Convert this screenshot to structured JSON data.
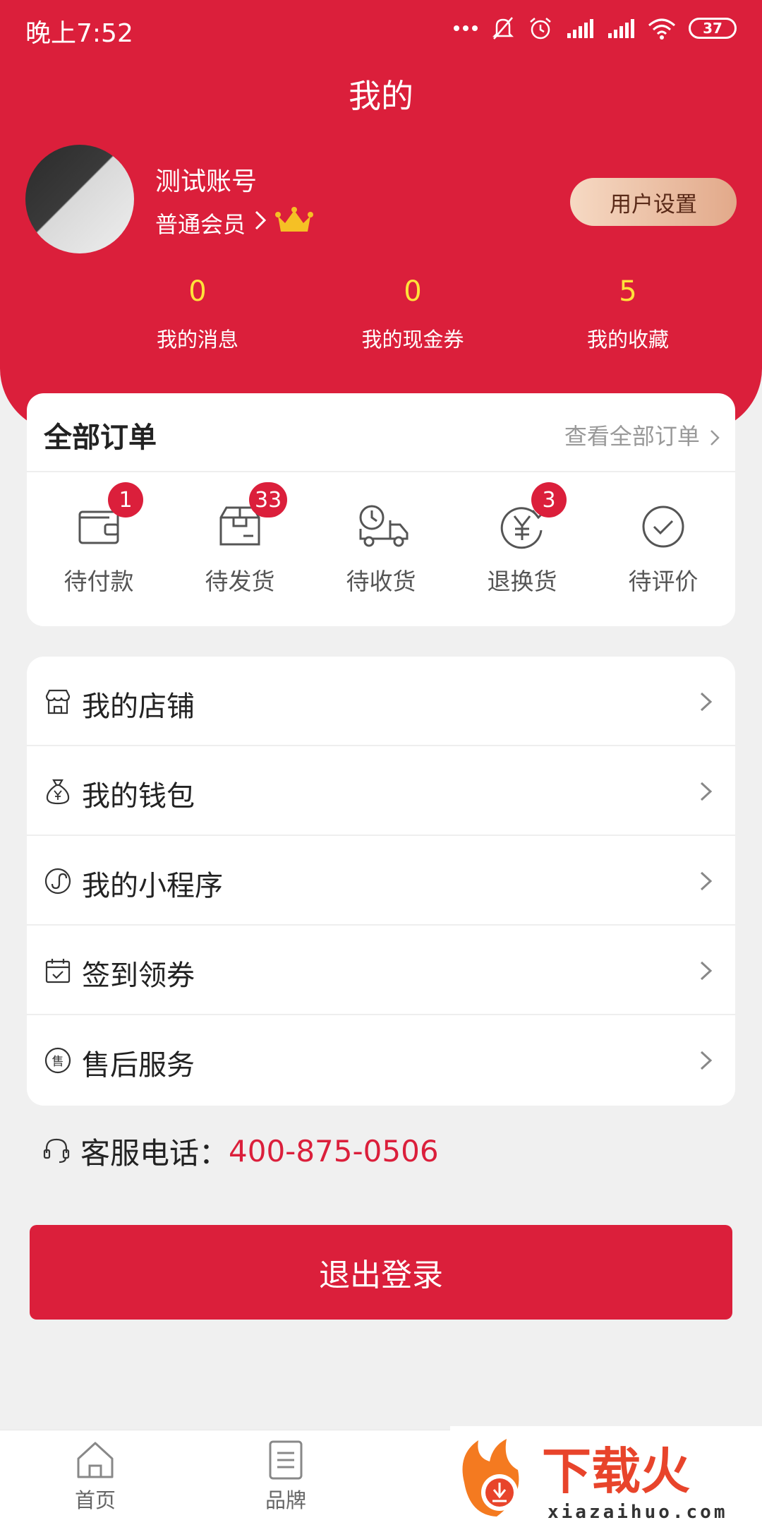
{
  "status_bar": {
    "time": "晚上7:52",
    "battery": "37"
  },
  "header": {
    "title": "我的"
  },
  "profile": {
    "name": "测试账号",
    "member_level": "普通会员",
    "settings_label": "用户设置"
  },
  "stats": [
    {
      "value": "0",
      "label": "我的消息"
    },
    {
      "value": "0",
      "label": "我的现金券"
    },
    {
      "value": "5",
      "label": "我的收藏"
    }
  ],
  "orders": {
    "title": "全部订单",
    "view_all": "查看全部订单",
    "items": [
      {
        "label": "待付款",
        "badge": "1",
        "icon": "wallet-icon"
      },
      {
        "label": "待发货",
        "badge": "33",
        "icon": "package-icon"
      },
      {
        "label": "待收货",
        "badge": "",
        "icon": "truck-icon"
      },
      {
        "label": "退换货",
        "badge": "3",
        "icon": "yen-return-icon"
      },
      {
        "label": "待评价",
        "badge": "",
        "icon": "check-circle-icon"
      }
    ]
  },
  "menu": [
    {
      "label": "我的店铺",
      "icon": "store-icon"
    },
    {
      "label": "我的钱包",
      "icon": "money-bag-icon"
    },
    {
      "label": "我的小程序",
      "icon": "mini-program-icon"
    },
    {
      "label": "签到领券",
      "icon": "calendar-check-icon"
    },
    {
      "label": "售后服务",
      "icon": "after-sales-icon"
    }
  ],
  "customer_service": {
    "label": "客服电话：",
    "phone": "400-875-0506"
  },
  "logout_label": "退出登录",
  "tab_bar": [
    {
      "label": "首页",
      "icon": "home-icon"
    },
    {
      "label": "品牌",
      "icon": "list-icon"
    }
  ],
  "watermark": {
    "text": "下载火",
    "domain": "xiazaihuo.com"
  },
  "colors": {
    "primary": "#db1f3b",
    "stat_number": "#ffe23a",
    "settings_gradient_start": "#f6d9c3",
    "settings_gradient_end": "#e2a98a"
  }
}
